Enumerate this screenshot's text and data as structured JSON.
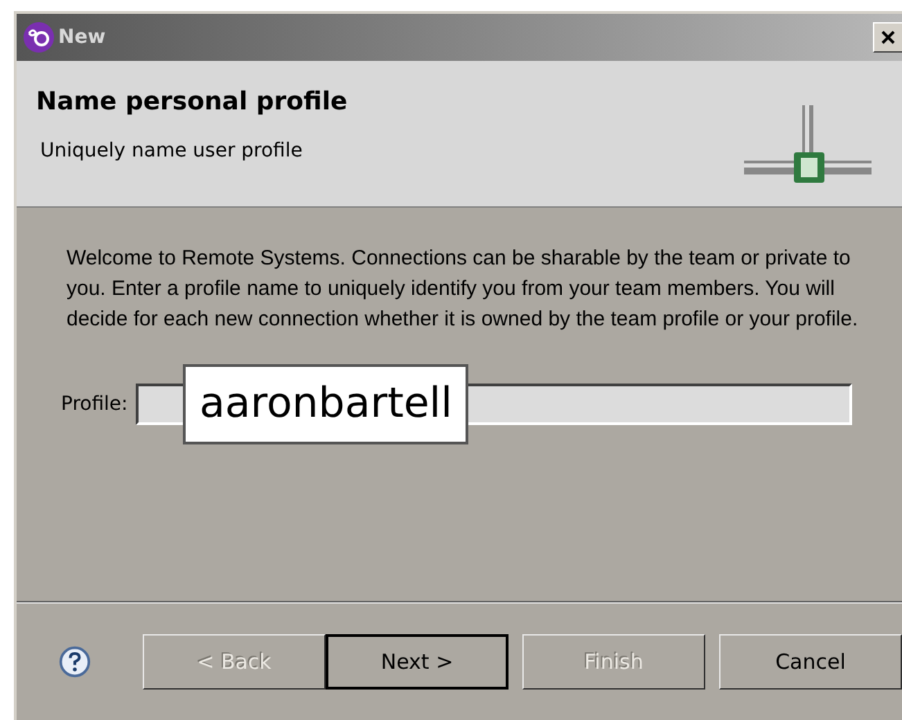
{
  "window": {
    "title": "New"
  },
  "header": {
    "title": "Name personal profile",
    "subtitle": "Uniquely name user profile"
  },
  "description": "Welcome to Remote Systems. Connections can be sharable by the team or private to you. Enter a profile name to uniquely identify you from your team members. You will decide for each new connection whether it is owned by the team profile or your profile.",
  "profile": {
    "label": "Profile:",
    "value": "aaronbartell"
  },
  "buttons": [
    {
      "label": "< Back",
      "disabled": true,
      "default": false
    },
    {
      "label": "Next >",
      "disabled": false,
      "default": true
    },
    {
      "label": "Finish",
      "disabled": true,
      "default": false
    },
    {
      "label": "Cancel",
      "disabled": false,
      "default": false
    }
  ]
}
